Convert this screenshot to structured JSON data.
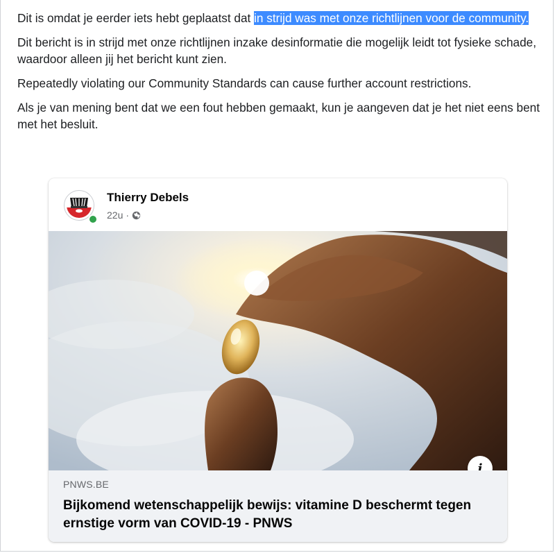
{
  "notice": {
    "line1_before": "Dit is omdat je eerder iets hebt geplaatst dat ",
    "line1_highlight": "in strijd was met onze richtlijnen voor de community.",
    "p2": "Dit bericht is in strijd met onze richtlijnen inzake desinformatie die mogelijk leidt tot fysieke schade, waardoor alleen jij het bericht kunt zien.",
    "p3": "Repeatedly violating our Community Standards can cause further account restrictions.",
    "p4": "Als je van mening bent dat we een fout hebben gemaakt, kun je aangeven dat je het niet eens bent met het besluit."
  },
  "post": {
    "author": "Thierry Debels",
    "time": "22u",
    "separator": "·",
    "privacy_icon": "globe-icon",
    "online_status_color": "#31a24c",
    "link": {
      "domain": "PNWS.BE",
      "title": "Bijkomend wetenschappelijk bewijs: vitamine D beschermt tegen ernstige vorm van COVID-19 - PNWS"
    },
    "info_button_label": "i"
  },
  "colors": {
    "highlight": "#3d8bff",
    "link_box_bg": "#f0f2f5",
    "secondary_text": "#65676b"
  }
}
